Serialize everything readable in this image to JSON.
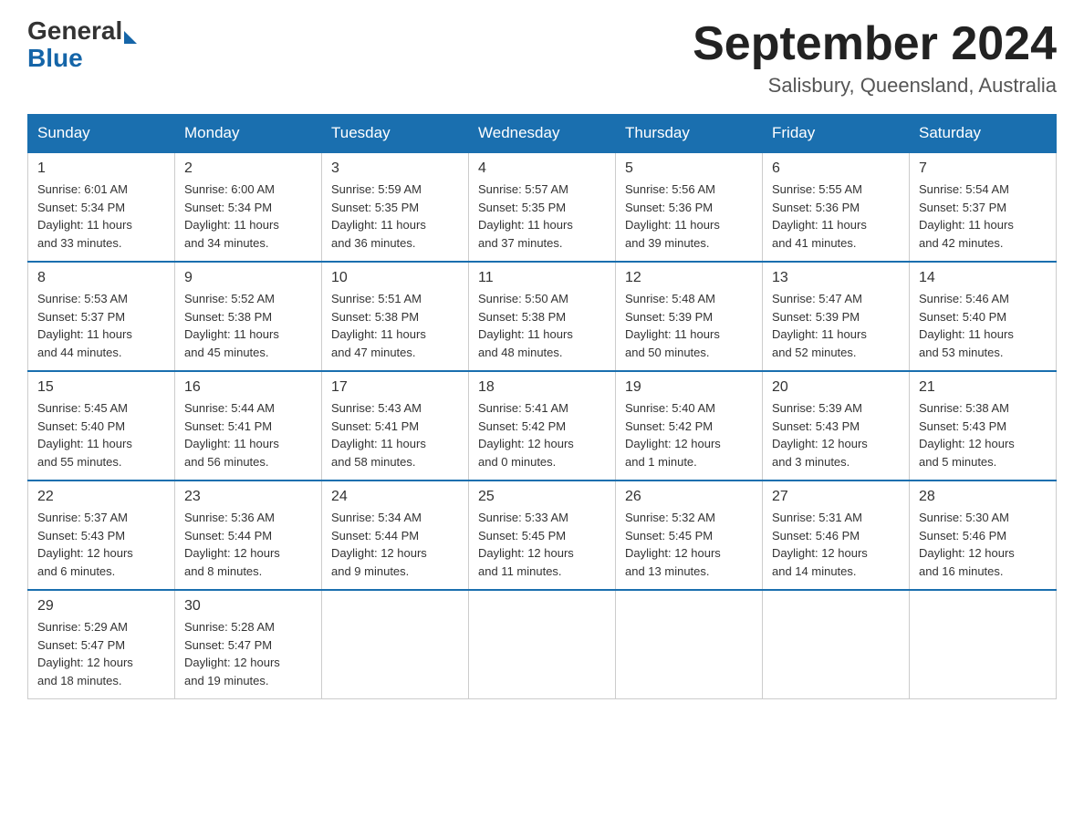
{
  "logo": {
    "general": "General",
    "blue": "Blue",
    "arrow": "▶"
  },
  "title": "September 2024",
  "subtitle": "Salisbury, Queensland, Australia",
  "weekdays": [
    "Sunday",
    "Monday",
    "Tuesday",
    "Wednesday",
    "Thursday",
    "Friday",
    "Saturday"
  ],
  "weeks": [
    [
      {
        "day": "1",
        "sunrise": "6:01 AM",
        "sunset": "5:34 PM",
        "daylight": "11 hours and 33 minutes."
      },
      {
        "day": "2",
        "sunrise": "6:00 AM",
        "sunset": "5:34 PM",
        "daylight": "11 hours and 34 minutes."
      },
      {
        "day": "3",
        "sunrise": "5:59 AM",
        "sunset": "5:35 PM",
        "daylight": "11 hours and 36 minutes."
      },
      {
        "day": "4",
        "sunrise": "5:57 AM",
        "sunset": "5:35 PM",
        "daylight": "11 hours and 37 minutes."
      },
      {
        "day": "5",
        "sunrise": "5:56 AM",
        "sunset": "5:36 PM",
        "daylight": "11 hours and 39 minutes."
      },
      {
        "day": "6",
        "sunrise": "5:55 AM",
        "sunset": "5:36 PM",
        "daylight": "11 hours and 41 minutes."
      },
      {
        "day": "7",
        "sunrise": "5:54 AM",
        "sunset": "5:37 PM",
        "daylight": "11 hours and 42 minutes."
      }
    ],
    [
      {
        "day": "8",
        "sunrise": "5:53 AM",
        "sunset": "5:37 PM",
        "daylight": "11 hours and 44 minutes."
      },
      {
        "day": "9",
        "sunrise": "5:52 AM",
        "sunset": "5:38 PM",
        "daylight": "11 hours and 45 minutes."
      },
      {
        "day": "10",
        "sunrise": "5:51 AM",
        "sunset": "5:38 PM",
        "daylight": "11 hours and 47 minutes."
      },
      {
        "day": "11",
        "sunrise": "5:50 AM",
        "sunset": "5:38 PM",
        "daylight": "11 hours and 48 minutes."
      },
      {
        "day": "12",
        "sunrise": "5:48 AM",
        "sunset": "5:39 PM",
        "daylight": "11 hours and 50 minutes."
      },
      {
        "day": "13",
        "sunrise": "5:47 AM",
        "sunset": "5:39 PM",
        "daylight": "11 hours and 52 minutes."
      },
      {
        "day": "14",
        "sunrise": "5:46 AM",
        "sunset": "5:40 PM",
        "daylight": "11 hours and 53 minutes."
      }
    ],
    [
      {
        "day": "15",
        "sunrise": "5:45 AM",
        "sunset": "5:40 PM",
        "daylight": "11 hours and 55 minutes."
      },
      {
        "day": "16",
        "sunrise": "5:44 AM",
        "sunset": "5:41 PM",
        "daylight": "11 hours and 56 minutes."
      },
      {
        "day": "17",
        "sunrise": "5:43 AM",
        "sunset": "5:41 PM",
        "daylight": "11 hours and 58 minutes."
      },
      {
        "day": "18",
        "sunrise": "5:41 AM",
        "sunset": "5:42 PM",
        "daylight": "12 hours and 0 minutes."
      },
      {
        "day": "19",
        "sunrise": "5:40 AM",
        "sunset": "5:42 PM",
        "daylight": "12 hours and 1 minute."
      },
      {
        "day": "20",
        "sunrise": "5:39 AM",
        "sunset": "5:43 PM",
        "daylight": "12 hours and 3 minutes."
      },
      {
        "day": "21",
        "sunrise": "5:38 AM",
        "sunset": "5:43 PM",
        "daylight": "12 hours and 5 minutes."
      }
    ],
    [
      {
        "day": "22",
        "sunrise": "5:37 AM",
        "sunset": "5:43 PM",
        "daylight": "12 hours and 6 minutes."
      },
      {
        "day": "23",
        "sunrise": "5:36 AM",
        "sunset": "5:44 PM",
        "daylight": "12 hours and 8 minutes."
      },
      {
        "day": "24",
        "sunrise": "5:34 AM",
        "sunset": "5:44 PM",
        "daylight": "12 hours and 9 minutes."
      },
      {
        "day": "25",
        "sunrise": "5:33 AM",
        "sunset": "5:45 PM",
        "daylight": "12 hours and 11 minutes."
      },
      {
        "day": "26",
        "sunrise": "5:32 AM",
        "sunset": "5:45 PM",
        "daylight": "12 hours and 13 minutes."
      },
      {
        "day": "27",
        "sunrise": "5:31 AM",
        "sunset": "5:46 PM",
        "daylight": "12 hours and 14 minutes."
      },
      {
        "day": "28",
        "sunrise": "5:30 AM",
        "sunset": "5:46 PM",
        "daylight": "12 hours and 16 minutes."
      }
    ],
    [
      {
        "day": "29",
        "sunrise": "5:29 AM",
        "sunset": "5:47 PM",
        "daylight": "12 hours and 18 minutes."
      },
      {
        "day": "30",
        "sunrise": "5:28 AM",
        "sunset": "5:47 PM",
        "daylight": "12 hours and 19 minutes."
      },
      null,
      null,
      null,
      null,
      null
    ]
  ],
  "labels": {
    "sunrise": "Sunrise:",
    "sunset": "Sunset:",
    "daylight": "Daylight:"
  }
}
